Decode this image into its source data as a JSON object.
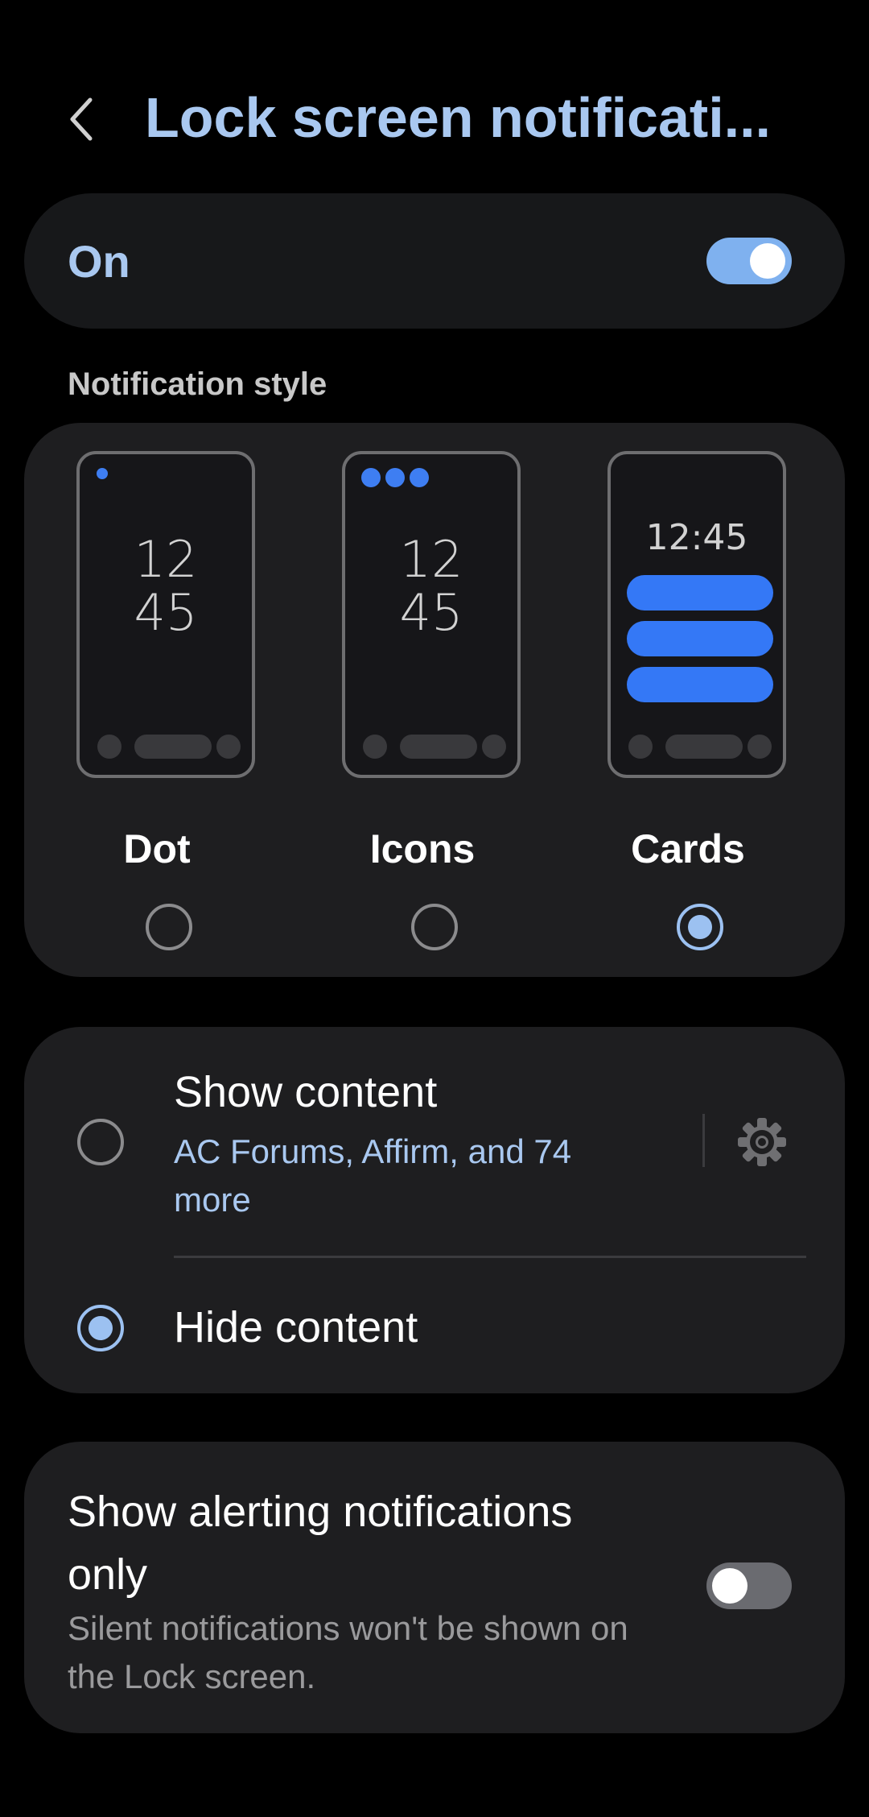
{
  "header": {
    "title": "Lock screen notificati..."
  },
  "master_toggle": {
    "label": "On",
    "state": "on"
  },
  "notification_style": {
    "section_label": "Notification style",
    "options": [
      {
        "label": "Dot",
        "preview_time": [
          "12",
          "45"
        ],
        "selected": false
      },
      {
        "label": "Icons",
        "preview_time": [
          "12",
          "45"
        ],
        "selected": false
      },
      {
        "label": "Cards",
        "preview_time": [
          "12:45"
        ],
        "selected": true
      }
    ]
  },
  "content_visibility": {
    "show_content": {
      "title": "Show content",
      "subtitle": "AC Forums, Affirm, and 74 more",
      "selected": false
    },
    "hide_content": {
      "title": "Hide content",
      "selected": true
    }
  },
  "alerting": {
    "title": "Show alerting notifications only",
    "subtitle": "Silent notifications won't be shown on the Lock screen.",
    "state": "off"
  },
  "colors": {
    "accent": "#a9c8f0",
    "toggle_on": "#7fb1ef",
    "card_bg": "#1e1e20",
    "preview_blue": "#3478f6"
  }
}
